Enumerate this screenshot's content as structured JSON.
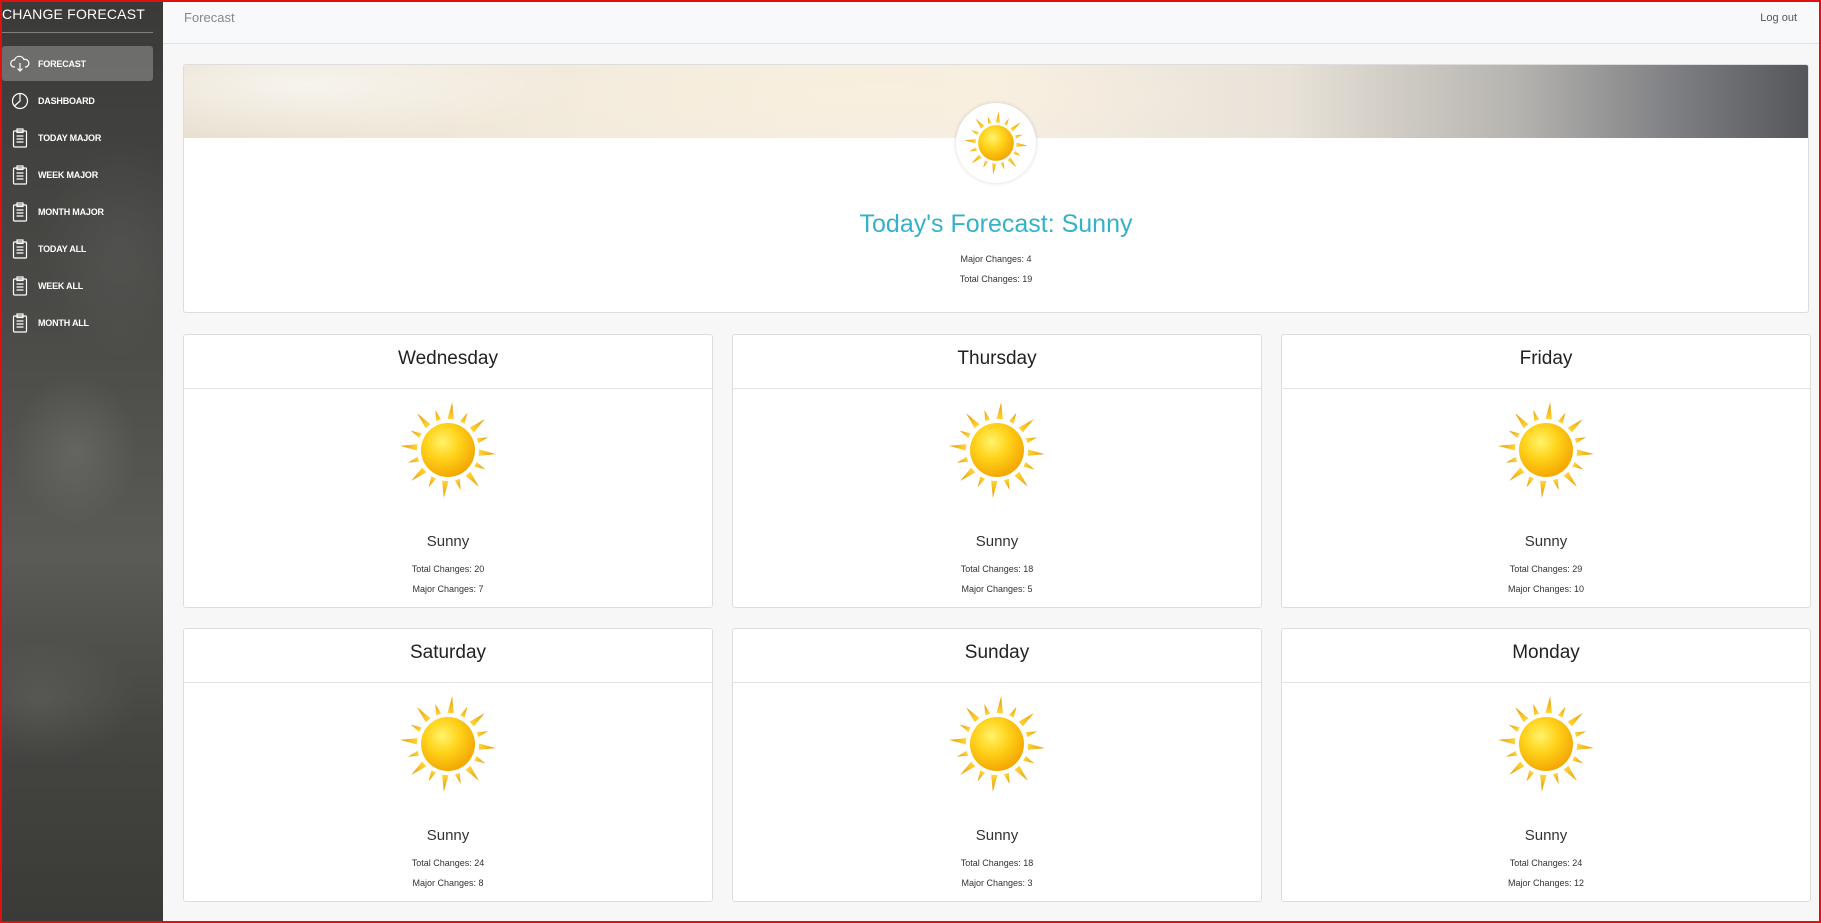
{
  "app": {
    "brand": "CHANGE FORECAST"
  },
  "sidebar": {
    "items": [
      {
        "label": "FORECAST",
        "icon": "cloud-download-icon",
        "active": true
      },
      {
        "label": "DASHBOARD",
        "icon": "pie-chart-icon",
        "active": false
      },
      {
        "label": "TODAY MAJOR",
        "icon": "clipboard-icon",
        "active": false
      },
      {
        "label": "WEEK MAJOR",
        "icon": "clipboard-icon",
        "active": false
      },
      {
        "label": "MONTH MAJOR",
        "icon": "clipboard-icon",
        "active": false
      },
      {
        "label": "TODAY ALL",
        "icon": "clipboard-icon",
        "active": false
      },
      {
        "label": "WEEK ALL",
        "icon": "clipboard-icon",
        "active": false
      },
      {
        "label": "MONTH ALL",
        "icon": "clipboard-icon",
        "active": false
      }
    ]
  },
  "topbar": {
    "title": "Forecast",
    "logout": "Log out"
  },
  "today": {
    "headline": "Today's Forecast: Sunny",
    "icon": "sun-icon",
    "major": "Major Changes: 4",
    "total": "Total Changes: 19"
  },
  "days": [
    {
      "name": "Wednesday",
      "condition": "Sunny",
      "line1": "Total Changes: 20",
      "line2": "Major Changes: 7",
      "icon": "sun-icon"
    },
    {
      "name": "Thursday",
      "condition": "Sunny",
      "line1": "Total Changes: 18",
      "line2": "Major Changes: 5",
      "icon": "sun-icon"
    },
    {
      "name": "Friday",
      "condition": "Sunny",
      "line1": "Total Changes: 29",
      "line2": "Major Changes: 10",
      "icon": "sun-icon"
    },
    {
      "name": "Saturday",
      "condition": "Sunny",
      "line1": "Total Changes: 24",
      "line2": "Major Changes: 8",
      "icon": "sun-icon"
    },
    {
      "name": "Sunday",
      "condition": "Sunny",
      "line1": "Total Changes: 18",
      "line2": "Major Changes: 3",
      "icon": "sun-icon"
    },
    {
      "name": "Monday",
      "condition": "Sunny",
      "line1": "Total Changes: 24",
      "line2": "Major Changes: 12",
      "icon": "sun-icon"
    }
  ],
  "colors": {
    "accent": "#34b2c9",
    "sun": "#f7b500",
    "frame": "#e01010"
  }
}
